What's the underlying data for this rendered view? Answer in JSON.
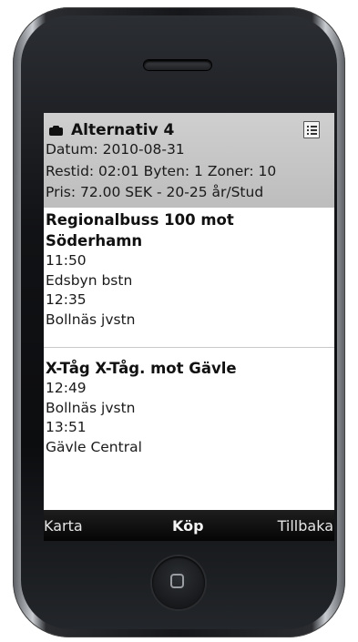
{
  "header": {
    "title": "Alternativ 4",
    "date": "Datum: 2010-08-31",
    "info": "Restid: 02:01  Byten: 1  Zoner: 10",
    "price": "Pris: 72.00 SEK - 20-25 år/Stud",
    "title_icon": "briefcase-icon",
    "menu_icon": "list-icon"
  },
  "trips": [
    {
      "title_line1": "Regionalbuss 100 mot",
      "title_line2": "Söderhamn",
      "dep_time": "11:50",
      "dep_stop": "Edsbyn bstn",
      "arr_time": "12:35",
      "arr_stop": "Bollnäs jvstn"
    },
    {
      "title": "X-Tåg X-Tåg. mot Gävle",
      "dep_time": "12:49",
      "dep_stop": "Bollnäs jvstn",
      "arr_time": "13:51",
      "arr_stop": "Gävle Central"
    }
  ],
  "bottom_bar": {
    "left": "Karta",
    "center": "Köp",
    "right": "Tillbaka"
  },
  "colors": {
    "header_bg": "#c6c6c6",
    "bottom_bar_bg": "#111111",
    "phone_body": "#16171a"
  }
}
